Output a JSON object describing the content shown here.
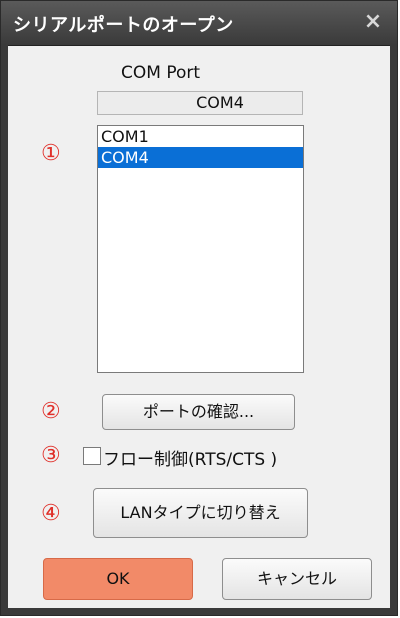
{
  "title": "シリアルポートのオープン",
  "close_icon": "×",
  "com_port": {
    "label": "COM Port",
    "current_value": "COM4"
  },
  "port_list": [
    {
      "label": "COM1",
      "selected": false
    },
    {
      "label": "COM4",
      "selected": true
    }
  ],
  "markers": {
    "m1": "①",
    "m2": "②",
    "m3": "③",
    "m4": "④"
  },
  "buttons": {
    "check_port": "ポートの確認...",
    "lan_type": "LANタイプに切り替え",
    "ok": "OK",
    "cancel": "キャンセル"
  },
  "flow_control": {
    "label": "フロー制御(RTS/CTS )",
    "checked": false
  },
  "colors": {
    "accent_ok": "#f28a68",
    "selection": "#0a6fd6",
    "marker": "#e0302a",
    "titlebar": "#4a4a4a"
  }
}
